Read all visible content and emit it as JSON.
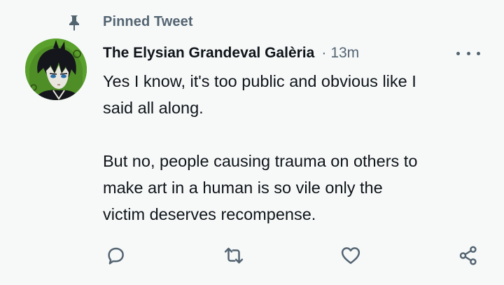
{
  "pinned": {
    "label": "Pinned Tweet",
    "icon": "pin-icon"
  },
  "author": {
    "display_name": "The Elysian Grandeval Galèria",
    "separator": "·",
    "timestamp": "13m",
    "avatar": "avatar"
  },
  "tweet": {
    "text": "Yes I know, it's too public and obvious like I\nsaid all along.\n\nBut no, people causing trauma on others to\nmake art in a human is so vile only the\nvictim deserves recompense."
  },
  "actions": [
    {
      "name": "reply",
      "icon": "reply-icon"
    },
    {
      "name": "retweet",
      "icon": "retweet-icon"
    },
    {
      "name": "like",
      "icon": "heart-icon"
    },
    {
      "name": "share",
      "icon": "share-icon"
    }
  ],
  "colors": {
    "background": "#f7f9f9",
    "text": "#0f1419",
    "secondary": "#536471",
    "avatar_bg": "#5aa02c"
  }
}
